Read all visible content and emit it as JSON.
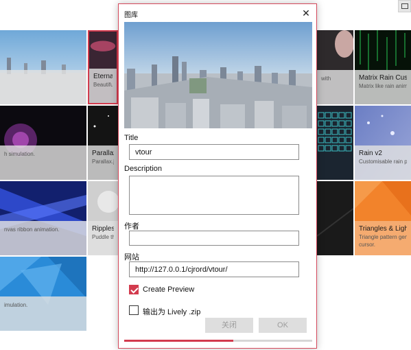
{
  "window": {
    "restore_icon": "restore-icon"
  },
  "gallery": {
    "tiles": [
      {
        "id": "tile-city",
        "title": "",
        "desc": ""
      },
      {
        "id": "tile-eternal",
        "title": "Eternal Li",
        "desc": "Beautiful s"
      },
      {
        "id": "tile-top-right",
        "title": "",
        "desc": "with"
      },
      {
        "id": "tile-matrix",
        "title": "Matrix Rain Custo",
        "desc": "Matrix like rain anima"
      },
      {
        "id": "tile-fluid",
        "title": "",
        "desc": "h simulation."
      },
      {
        "id": "tile-parallax",
        "title": "Parallax.js",
        "desc": "Parallax.js e"
      },
      {
        "id": "tile-grid",
        "title": "",
        "desc": ""
      },
      {
        "id": "tile-rain",
        "title": "Rain v2",
        "desc": "Customisable rain pa"
      },
      {
        "id": "tile-ribbon",
        "title": "",
        "desc": "nvas ribbon animation."
      },
      {
        "id": "tile-ripples",
        "title": "Ripples",
        "desc": "Puddle tha"
      },
      {
        "id": "tile-dark",
        "title": "",
        "desc": ""
      },
      {
        "id": "tile-triangles",
        "title": "Triangles & Light",
        "desc": "Triangle pattern gene",
        "desc2": "cursor."
      },
      {
        "id": "tile-blue",
        "title": "",
        "desc": "imulation."
      }
    ]
  },
  "dialog": {
    "title": "图库",
    "close_icon": "close-icon",
    "fields": {
      "title_label": "Title",
      "title_value": "vtour",
      "description_label": "Description",
      "description_value": "",
      "author_label": "作者",
      "author_value": "",
      "website_label": "网站",
      "website_value": "http://127.0.0.1/cjrord/vtour/"
    },
    "create_preview": {
      "label": "Create Preview",
      "checked": true
    },
    "export_zip": {
      "label": "输出为 Lively .zip",
      "checked": false
    },
    "buttons": {
      "close": "关闭",
      "ok": "OK"
    },
    "progress": 0.58
  },
  "colors": {
    "accent": "#d23b4e",
    "tile_caption": "#e1e1e1"
  }
}
